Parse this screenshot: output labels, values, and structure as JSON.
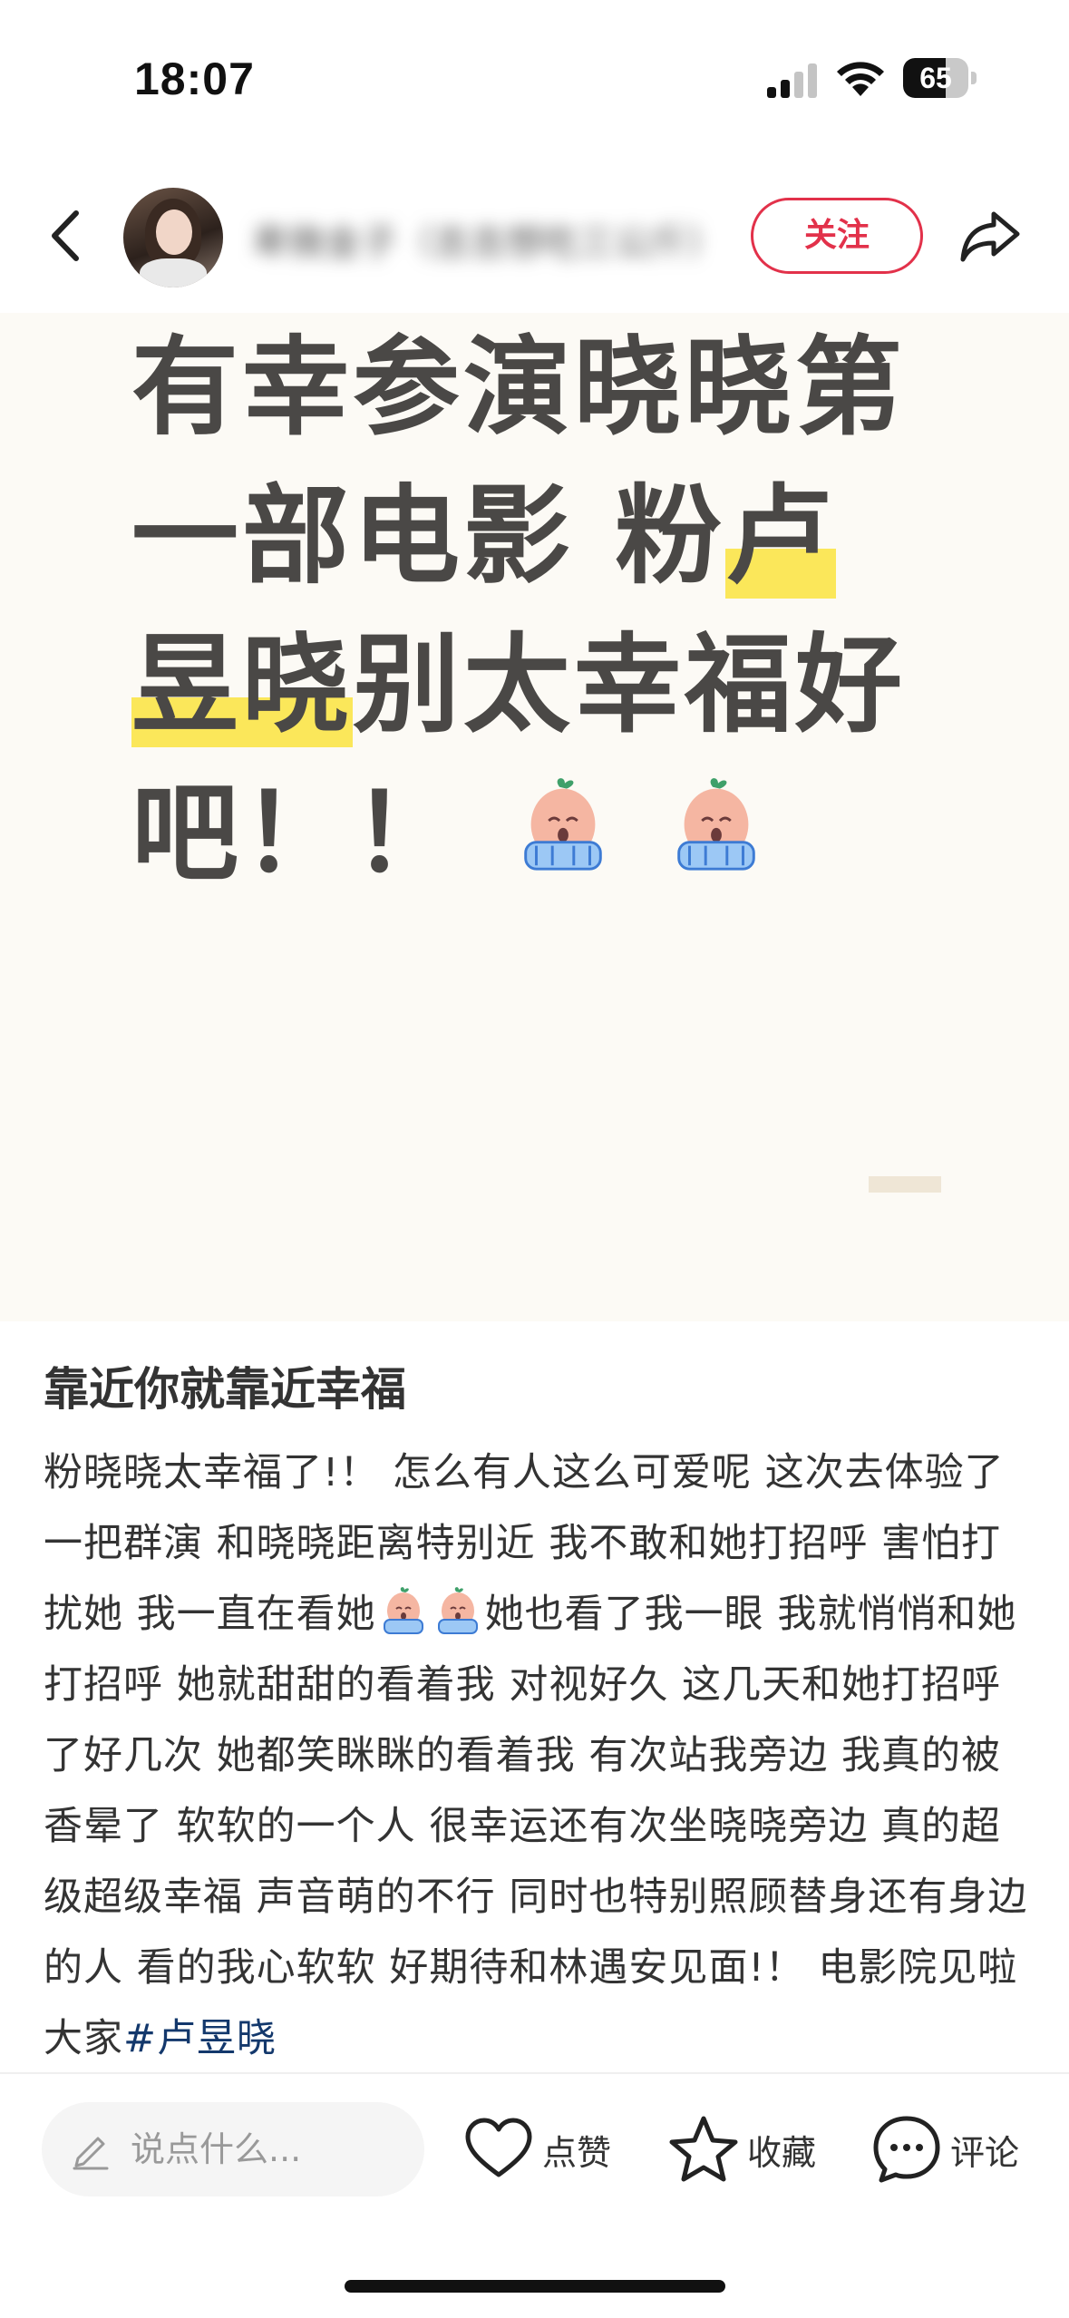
{
  "status_bar": {
    "time": "18:07",
    "battery": "65",
    "battery_level": 0.65
  },
  "header": {
    "back_icon": "chevron-left-icon",
    "username": "卑微金子（吉吉想吃三公斤）",
    "follow_label": "关注",
    "share_icon": "share-arrow-icon"
  },
  "cover": {
    "line1": "有幸参演晓晓第",
    "line2_a": "一部电影 粉",
    "line2_hl": "卢",
    "line3_hl": "昱晓",
    "line3_b": "别太幸福好",
    "line4": "吧！！",
    "emoji": "crying-peach-emoji"
  },
  "post": {
    "title": "靠近你就靠近幸福",
    "body_part1": "粉晓晓太幸福了!！ 怎么有人这么可爱呢 这次去体验了一把群演 和晓晓距离特别近 我不敢和她打招呼 害怕打扰她 我一直在看她",
    "body_part2": "她也看了我一眼 我就悄悄和她打招呼 她就甜甜的看着我 对视好久 这几天和她打招呼了好几次 她都笑眯眯的看着我 有次站我旁边 我真的被香晕了 软软的一个人 很幸运还有次坐晓晓旁边 真的超级超级幸福 声音萌的不行 同时也特别照顾替身还有身边的人 看的我心软软 好期待和林遇安见面!！ 电影院见啦大家",
    "hashtag": "#卢昱晓"
  },
  "bottom_bar": {
    "comment_placeholder": "说点什么...",
    "like_label": "点赞",
    "collect_label": "收藏",
    "comment_label": "评论"
  },
  "colors": {
    "accent": "#e2314a",
    "highlight": "#fbe75a",
    "hashtag": "#13386c"
  }
}
